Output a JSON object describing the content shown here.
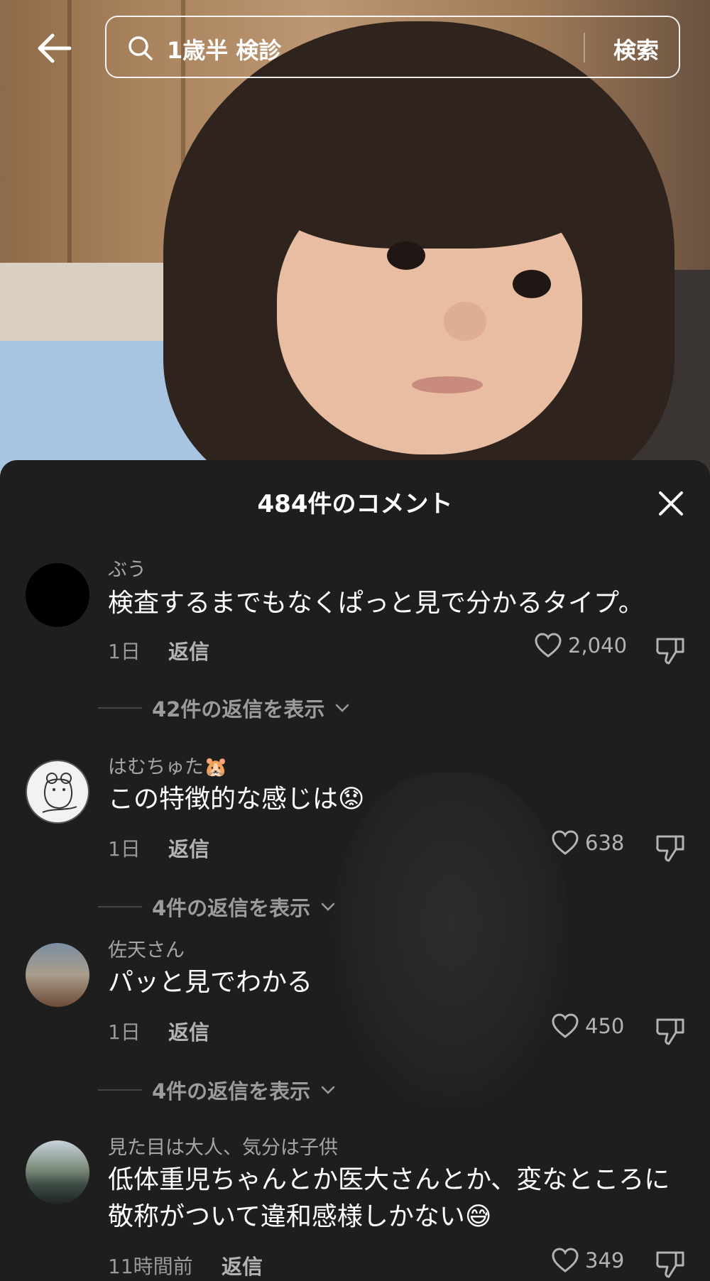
{
  "search": {
    "query": "1歳半 検診",
    "button_label": "検索"
  },
  "comments_panel": {
    "title": "484件のコメント",
    "comments": [
      {
        "username": "ぶう",
        "text": "検査するまでもなくぱっと見で分かるタイプ。",
        "time": "1日",
        "reply_label": "返信",
        "likes": "2,040",
        "view_replies": "42件の返信を表示"
      },
      {
        "username": "はむちゅた🐹",
        "text": "この特徴的な感じは😟",
        "time": "1日",
        "reply_label": "返信",
        "likes": "638",
        "view_replies": "4件の返信を表示"
      },
      {
        "username": "佐天さん",
        "text": "パッと見でわかる",
        "time": "1日",
        "reply_label": "返信",
        "likes": "450",
        "view_replies": "4件の返信を表示"
      },
      {
        "username": "見た目は大人、気分は子供",
        "text": "低体重児ちゃんとか医大さんとか、変なところに敬称がついて違和感様しかない😅",
        "time": "11時間前",
        "reply_label": "返信",
        "likes": "349"
      }
    ]
  },
  "icons": {
    "back": "arrow-left-icon",
    "search": "search-icon",
    "close": "close-icon",
    "like": "heart-icon",
    "dislike": "thumbs-down-icon",
    "expand": "chevron-down-icon"
  },
  "colors": {
    "panel_background": "#1e1e1e",
    "primary_text": "#ffffff",
    "secondary_text": "#a6a6a6"
  }
}
